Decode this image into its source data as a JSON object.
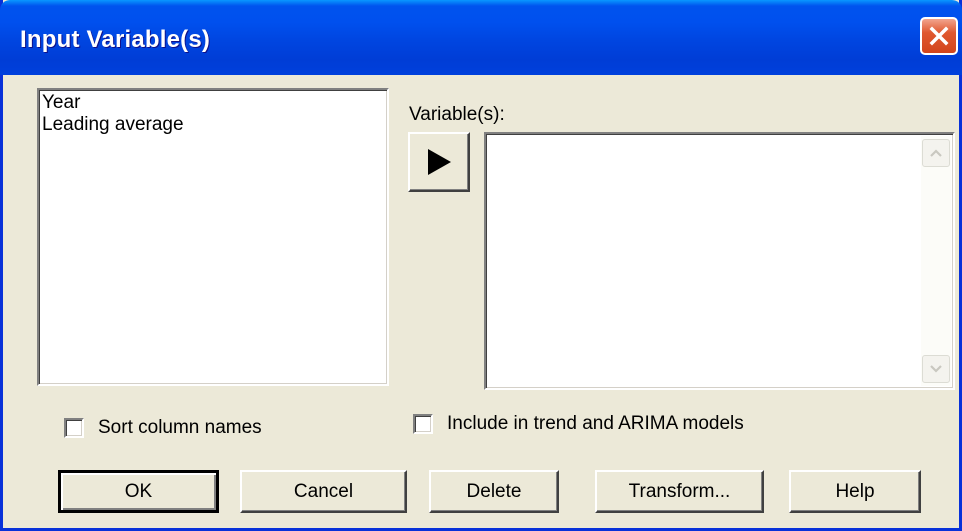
{
  "window": {
    "title": "Input Variable(s)",
    "title_color": "#ffffff",
    "titlebar_color": "#0050ee",
    "close_color": "#e0582f"
  },
  "source_list": {
    "items": [
      "Year",
      "Leading average"
    ]
  },
  "variables": {
    "label": "Variable(s):",
    "items": []
  },
  "arrow_icon": "right-triangle-arrow",
  "options": {
    "sort_column_names": {
      "label": "Sort column names",
      "checked": false
    },
    "include_trend_arima": {
      "label": "Include in trend and ARIMA models",
      "checked": false
    }
  },
  "buttons": {
    "ok": "OK",
    "cancel": "Cancel",
    "delete": "Delete",
    "transform": "Transform...",
    "help": "Help"
  }
}
